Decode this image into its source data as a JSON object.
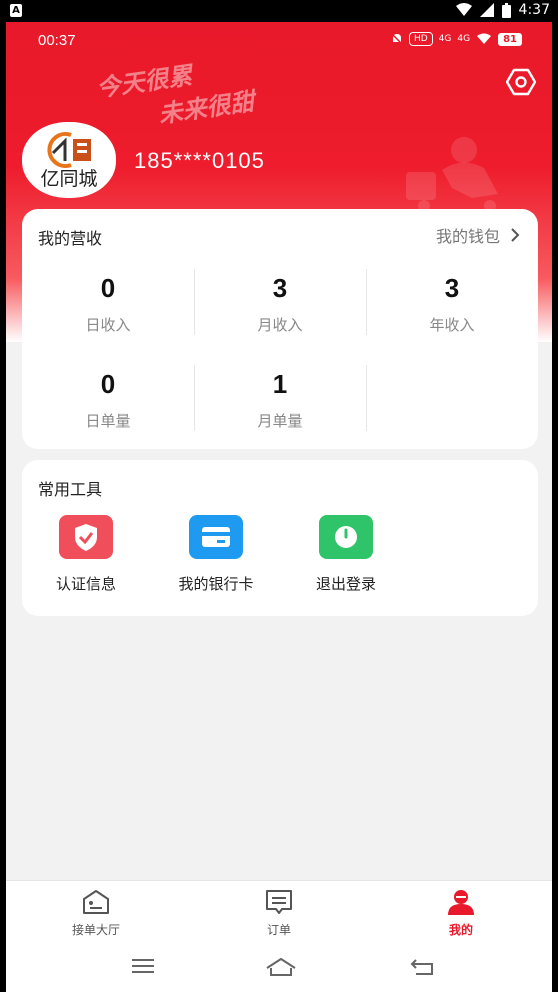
{
  "system_status": {
    "time": "4:37",
    "badge": "A"
  },
  "app_status": {
    "time": "00:37",
    "battery": "81",
    "hd": "HD",
    "signal1": "4G",
    "signal2": "4G"
  },
  "header": {
    "slogan_line1": "今天很累",
    "slogan_line2": "未来很甜",
    "logo_text": "亿同城",
    "phone": "185****0105"
  },
  "income": {
    "title": "我的营收",
    "wallet_label": "我的钱包",
    "stats": [
      {
        "value": "0",
        "label": "日收入"
      },
      {
        "value": "3",
        "label": "月收入"
      },
      {
        "value": "3",
        "label": "年收入"
      },
      {
        "value": "0",
        "label": "日单量"
      },
      {
        "value": "1",
        "label": "月单量"
      }
    ]
  },
  "tools": {
    "title": "常用工具",
    "items": [
      {
        "label": "认证信息",
        "icon": "shield-check-icon",
        "color": "#f04e5a"
      },
      {
        "label": "我的银行卡",
        "icon": "bank-card-icon",
        "color": "#1e9bf0"
      },
      {
        "label": "退出登录",
        "icon": "power-icon",
        "color": "#2fc46a"
      }
    ]
  },
  "bottom_nav": {
    "items": [
      {
        "label": "接单大厅",
        "icon": "hall-icon",
        "active": false
      },
      {
        "label": "订单",
        "icon": "order-icon",
        "active": false
      },
      {
        "label": "我的",
        "icon": "user-icon",
        "active": true
      }
    ]
  },
  "colors": {
    "brand_red": "#e8192a",
    "card_bg": "#ffffff",
    "page_bg": "#f2f2f3"
  }
}
